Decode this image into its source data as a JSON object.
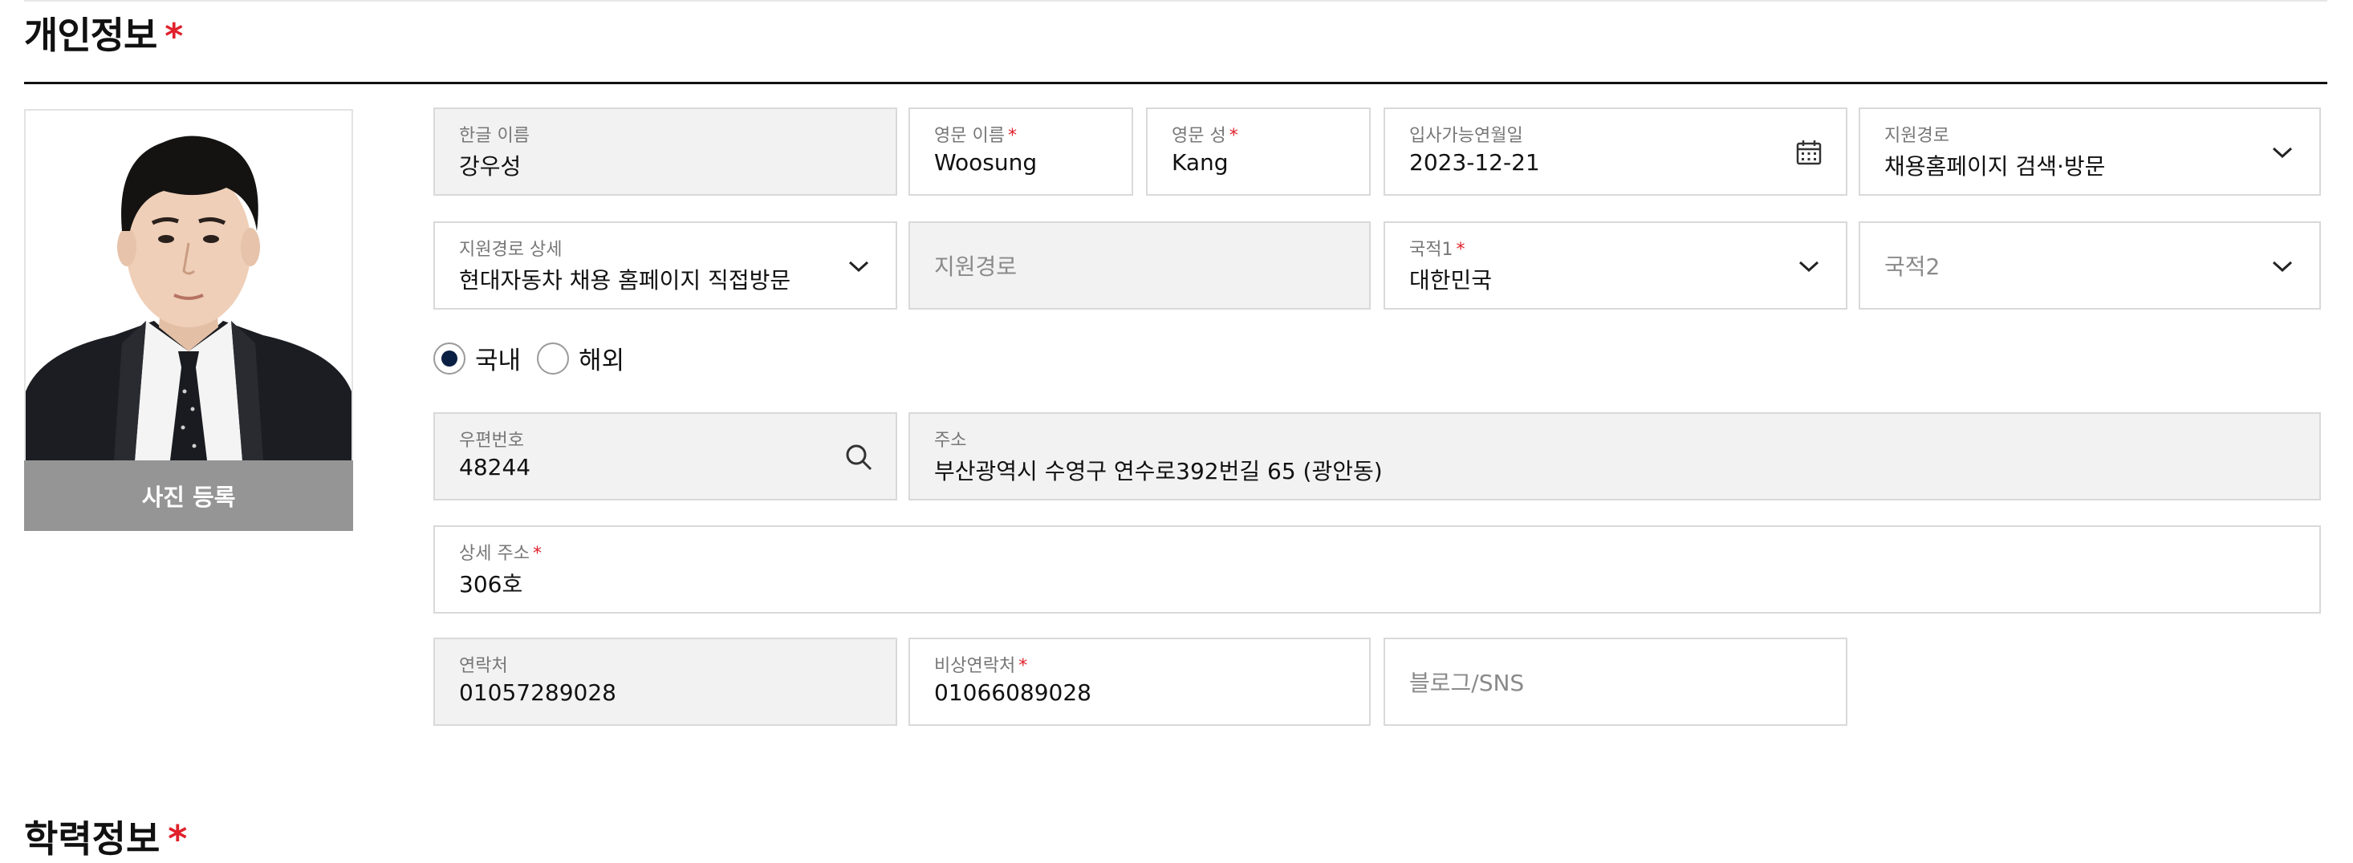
{
  "section": {
    "title": "개인정보",
    "required_mark": "*"
  },
  "photo": {
    "button_label": "사진 등록"
  },
  "fields": {
    "korean_name": {
      "label": "한글 이름",
      "value": "강우성"
    },
    "english_first": {
      "label": "영문 이름",
      "value": "Woosung"
    },
    "english_last": {
      "label": "영문 성",
      "value": "Kang"
    },
    "start_date": {
      "label": "입사가능연월일",
      "value": "2023-12-21",
      "icon": "calendar-icon"
    },
    "apply_route": {
      "label": "지원경로",
      "value": "채용홈페이지 검색·방문",
      "icon": "chevron-down-icon"
    },
    "apply_route_detail": {
      "label": "지원경로 상세",
      "value": "현대자동차 채용 홈페이지 직접방문",
      "icon": "chevron-down-icon"
    },
    "apply_route_text": {
      "placeholder": "지원경로"
    },
    "nationality1": {
      "label": "국적1",
      "value": "대한민국",
      "icon": "chevron-down-icon"
    },
    "nationality2": {
      "placeholder": "국적2",
      "icon": "chevron-down-icon"
    },
    "postal_code": {
      "label": "우편번호",
      "value": "48244",
      "icon": "search-icon"
    },
    "address": {
      "label": "주소",
      "value": "부산광역시 수영구 연수로392번길 65 (광안동)"
    },
    "address_detail": {
      "label": "상세 주소",
      "value": "306호"
    },
    "phone": {
      "label": "연락처",
      "value": "01057289028"
    },
    "emergency_phone": {
      "label": "비상연락처",
      "value": "01066089028"
    },
    "blog_sns": {
      "placeholder": "블로그/SNS"
    }
  },
  "address_type": {
    "options": [
      "국내",
      "해외"
    ],
    "selected": "국내"
  },
  "next_section": {
    "title": "학력정보",
    "required_mark": "*"
  },
  "colors": {
    "required": "#e0212b",
    "radio_selected": "#0a1f44",
    "disabled_bg": "#f2f2f2",
    "photo_button": "#959595"
  }
}
